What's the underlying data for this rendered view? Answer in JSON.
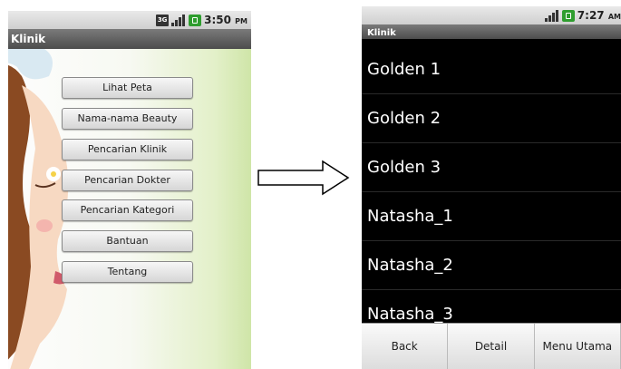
{
  "left_phone": {
    "status_time": "3:50",
    "status_ampm": "PM",
    "title": "Klinik",
    "menu": [
      "Lihat Peta",
      "Nama-nama Beauty",
      "Pencarian Klinik",
      "Pencarian Dokter",
      "Pencarian Kategori",
      "Bantuan",
      "Tentang"
    ]
  },
  "right_phone": {
    "status_time": "7:27",
    "status_ampm": "AM",
    "title": "Klinik",
    "list": [
      "Golden 1",
      "Golden 2",
      "Golden 3",
      "Natasha_1",
      "Natasha_2",
      "Natasha_3"
    ],
    "options_menu": [
      "Back",
      "Detail",
      "Menu Utama"
    ]
  },
  "icons": [
    "3g-icon",
    "signal-icon",
    "battery-icon",
    "arrow-right-icon"
  ]
}
